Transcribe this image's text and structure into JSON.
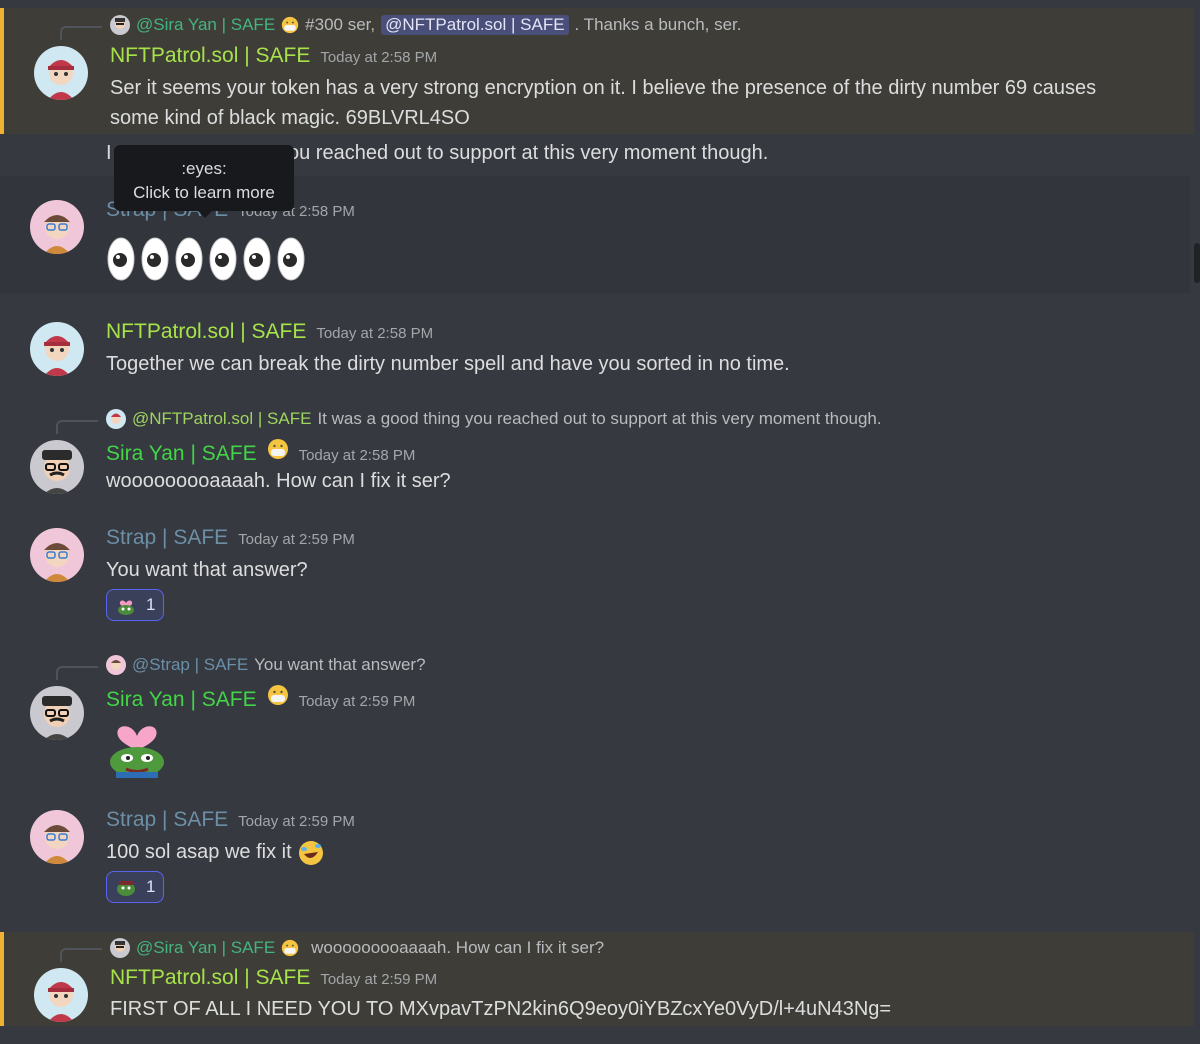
{
  "tooltip": {
    "code": ":eyes:",
    "hint": "Click to learn more"
  },
  "messages": [
    {
      "reply": {
        "name": "@Sira Yan | SAFE",
        "text": "#300 ser,",
        "mention": "@NFTPatrol.sol | SAFE",
        "tail": ".  Thanks a bunch, ser."
      },
      "author": "NFTPatrol.sol | SAFE",
      "time": "Today at 2:58 PM",
      "lines": [
        "Ser it seems your token has a very strong encryption on it. I believe the presence of the dirty number 69 causes some kind of black magic. 69BLVRL4SO"
      ]
    },
    {
      "text": "It was a good thing you reached out to support at this very moment though.",
      "visible_start": "I",
      "visible_end": "ou reached out to support at this very moment though."
    },
    {
      "author": "Strap | SAFE",
      "time": "Today at 2:58 PM",
      "eyes_count": 6
    },
    {
      "author": "NFTPatrol.sol | SAFE",
      "time": "Today at 2:58 PM",
      "text": "Together we can break the dirty number spell and have you sorted in no time."
    },
    {
      "reply": {
        "name": "@NFTPatrol.sol | SAFE",
        "text": "It was a good thing you reached out to support at this very moment though."
      },
      "author": "Sira Yan | SAFE",
      "time": "Today at 2:58 PM",
      "text": "wooooooooaaaah. How can I fix it ser?"
    },
    {
      "author": "Strap | SAFE",
      "time": "Today at 2:59 PM",
      "text": "You want that answer?",
      "reaction": {
        "emoji": "pepe-heart",
        "count": "1"
      }
    },
    {
      "reply": {
        "name": "@Strap | SAFE",
        "text": "You want that answer?"
      },
      "author": "Sira Yan | SAFE",
      "time": "Today at 2:59 PM",
      "big_emoji": "pepe-heart-emoji"
    },
    {
      "author": "Strap | SAFE",
      "time": "Today at 2:59 PM",
      "text": "100 sol asap we fix it",
      "reaction": {
        "emoji": "pepe-sad",
        "count": "1"
      }
    },
    {
      "reply": {
        "name": "@Sira Yan | SAFE",
        "text": "wooooooooaaaah. How can I fix it ser?"
      },
      "author": "NFTPatrol.sol | SAFE",
      "time": "Today at 2:59 PM",
      "text": "FIRST OF ALL I NEED YOU TO MXvpavTzPN2kin6Q9eoy0iYBZcxYe0VyD/l+4uN43Ng="
    }
  ],
  "colors": {
    "background": "#36393f",
    "mention_highlight": "#3f3d37",
    "mention_bar": "#f0b232",
    "nftpatrol_name": "#a6e34a",
    "sira_name": "#43d447",
    "strap_name": "#6c8fa6",
    "reaction_border": "#5865f2"
  }
}
